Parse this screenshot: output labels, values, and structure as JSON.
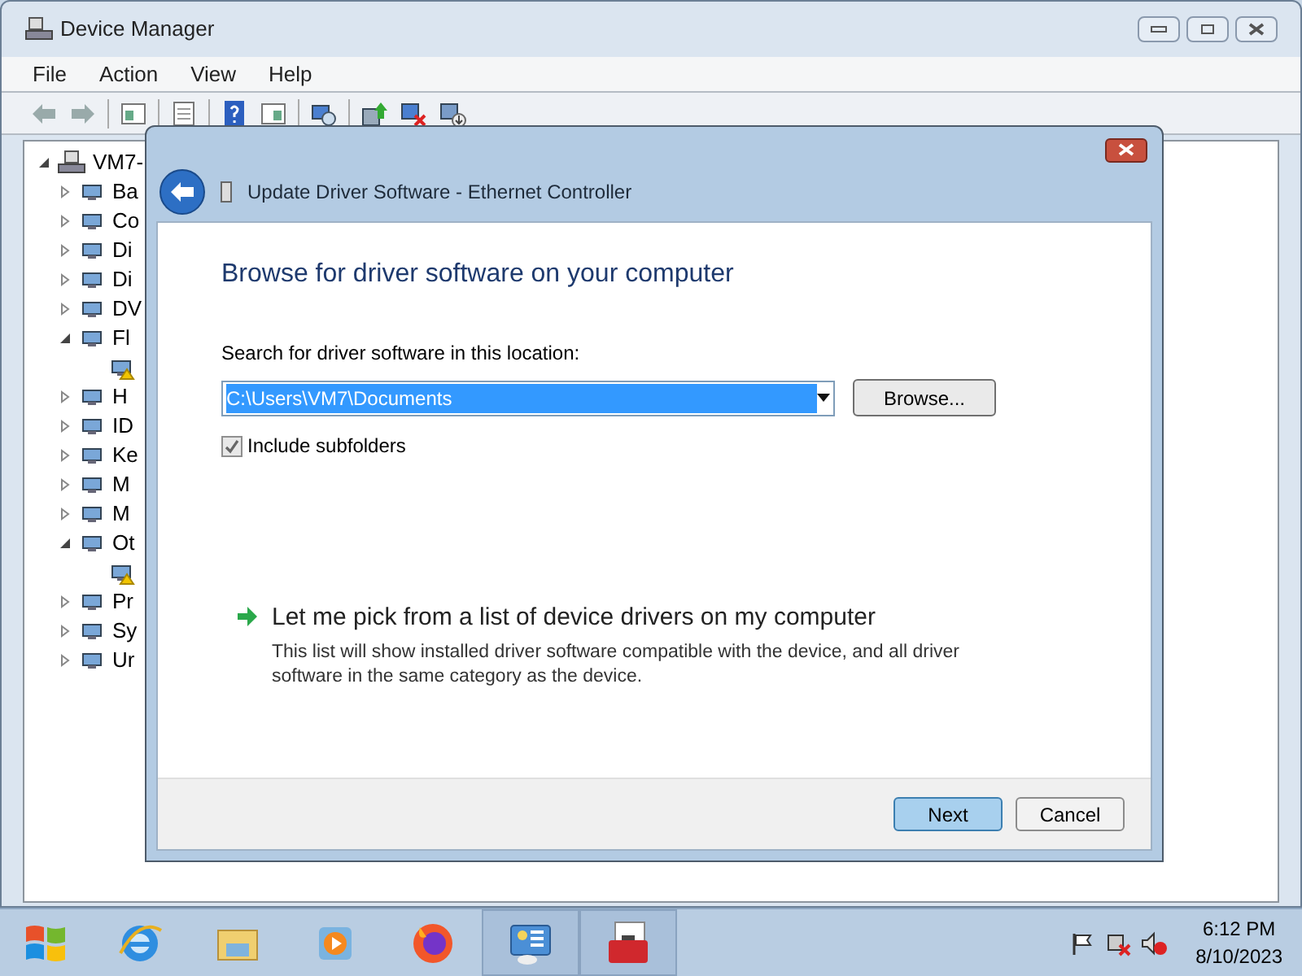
{
  "window": {
    "title": "Device Manager"
  },
  "menu": [
    "File",
    "Action",
    "View",
    "Help"
  ],
  "tree": {
    "label": "VM7-",
    "expanded": true,
    "children": [
      {
        "kind": "category",
        "label": "Ba",
        "expanded": false
      },
      {
        "kind": "category",
        "label": "Co",
        "expanded": false
      },
      {
        "kind": "category",
        "label": "Di",
        "expanded": false
      },
      {
        "kind": "category",
        "label": "Di",
        "expanded": false
      },
      {
        "kind": "category",
        "label": "DV",
        "expanded": false
      },
      {
        "kind": "category",
        "label": "Fl",
        "expanded": true,
        "children": [
          {
            "kind": "device",
            "warning": true
          }
        ]
      },
      {
        "kind": "category",
        "label": "H",
        "expanded": false
      },
      {
        "kind": "category",
        "label": "ID",
        "expanded": false
      },
      {
        "kind": "category",
        "label": "Ke",
        "expanded": false
      },
      {
        "kind": "category",
        "label": "M",
        "expanded": false
      },
      {
        "kind": "category",
        "label": "M",
        "expanded": false
      },
      {
        "kind": "category",
        "label": "Ot",
        "expanded": true,
        "children": [
          {
            "kind": "device",
            "warning": true
          }
        ]
      },
      {
        "kind": "category",
        "label": "Pr",
        "expanded": false
      },
      {
        "kind": "category",
        "label": "Sy",
        "expanded": false
      },
      {
        "kind": "category",
        "label": "Ur",
        "expanded": false
      }
    ]
  },
  "dialog": {
    "title": "Update Driver Software - Ethernet Controller",
    "heading": "Browse for driver software on your computer",
    "location_label": "Search for driver software in this location:",
    "location_value": "C:\\Users\\VM7\\Documents",
    "browse_button": "Browse...",
    "include_subfolders": {
      "label": "Include subfolders",
      "checked": true
    },
    "pick_link": "Let me pick from a list of device drivers on my computer",
    "pick_description": "This list will show installed driver software compatible with the device, and all driver software in the same category as the device.",
    "buttons": [
      {
        "label": "Next",
        "kind": "default"
      },
      {
        "label": "Cancel",
        "kind": "normal"
      }
    ]
  },
  "taskbar": {
    "time": "6:12 PM",
    "date": "8/10/2023"
  }
}
